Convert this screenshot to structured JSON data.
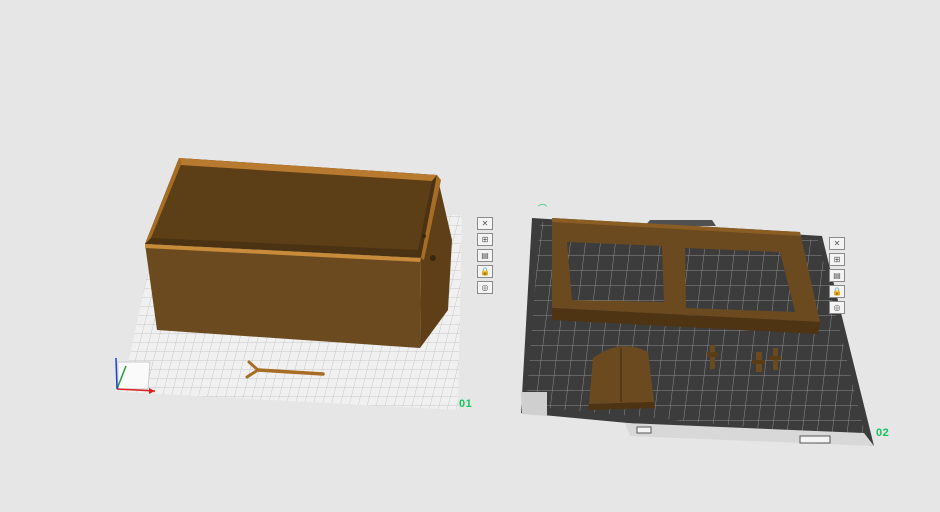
{
  "plates": [
    {
      "id": "plate-1",
      "label": "01",
      "selected": false
    },
    {
      "id": "plate-2",
      "label": "02",
      "selected": true
    }
  ],
  "plate_tools": [
    {
      "icon": "close-icon",
      "glyph": "✕"
    },
    {
      "icon": "arrange-icon",
      "glyph": "⊞"
    },
    {
      "icon": "orient-icon",
      "glyph": "▤"
    },
    {
      "icon": "lock-icon",
      "glyph": "🔒"
    },
    {
      "icon": "settings-icon",
      "glyph": "◎"
    }
  ],
  "colors": {
    "background": "#e6e6e6",
    "plate_light": "#f0f0f0",
    "plate_dark": "#3c3c3c",
    "model_brown": "#6b4a1f",
    "model_wood": "#b87a2e",
    "label_green": "#16c45a"
  },
  "axes": {
    "x_color": "#e02020",
    "y_color": "#20a040",
    "z_color": "#2040d0"
  }
}
